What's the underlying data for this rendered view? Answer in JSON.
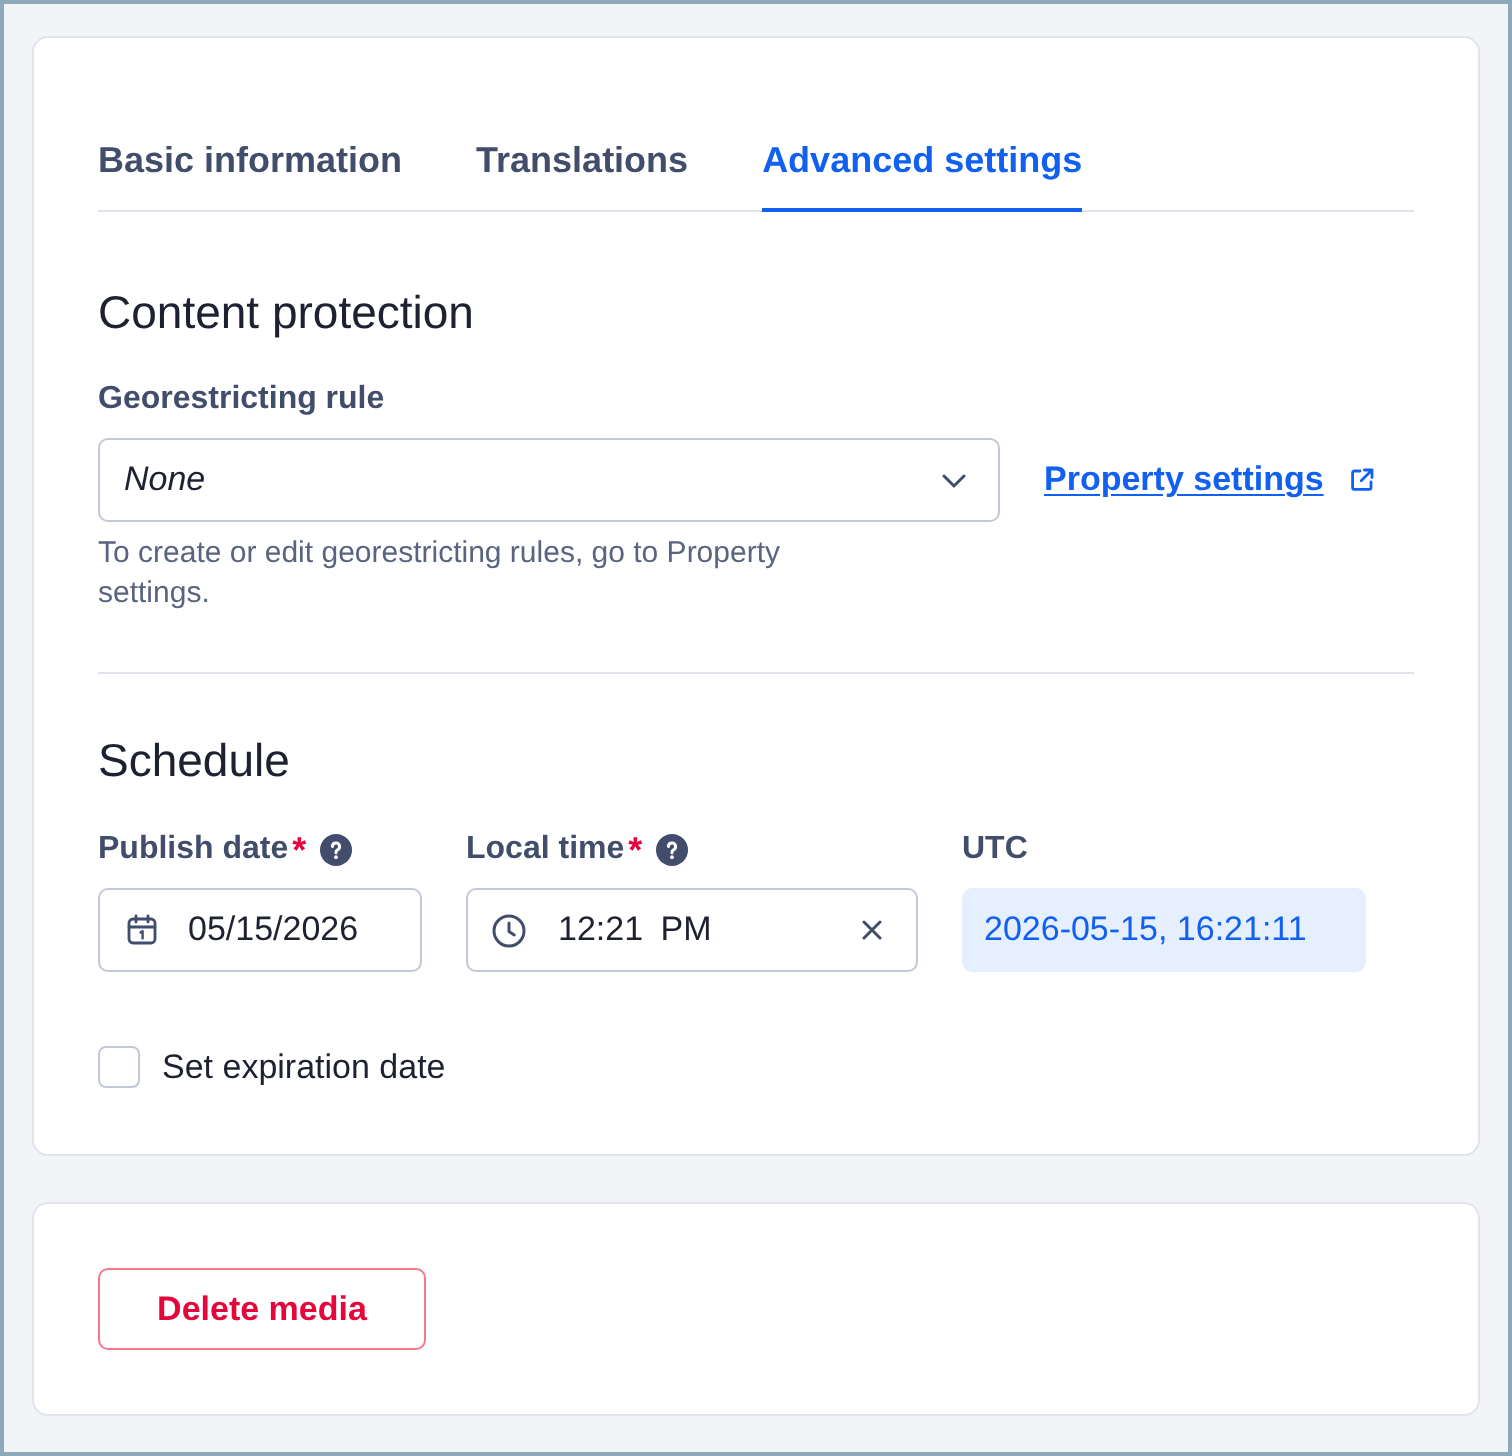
{
  "tabs": [
    {
      "label": "Basic information",
      "selected": false
    },
    {
      "label": "Translations",
      "selected": false
    },
    {
      "label": "Advanced settings",
      "selected": true
    }
  ],
  "content_protection": {
    "title": "Content protection",
    "georestricting_rule": {
      "label": "Georestricting rule",
      "value": "None"
    },
    "link": "Property settings",
    "help_text": "To create or edit georestricting rules, go to Property settings."
  },
  "schedule": {
    "title": "Schedule",
    "fields": [
      {
        "kind": "date",
        "label": "Publish date",
        "required_mark": "*",
        "help": true,
        "value": "05/15/2026"
      },
      {
        "kind": "time",
        "label": "Local time",
        "required_mark": "*",
        "help": true,
        "value": "12:21 PM",
        "clearable": true
      },
      {
        "kind": "readout",
        "label": "UTC",
        "value": "2026-05-15, 16:21:11"
      }
    ],
    "expiration": {
      "label": "Set expiration date",
      "checked": false
    }
  },
  "delete_button": "Delete media"
}
